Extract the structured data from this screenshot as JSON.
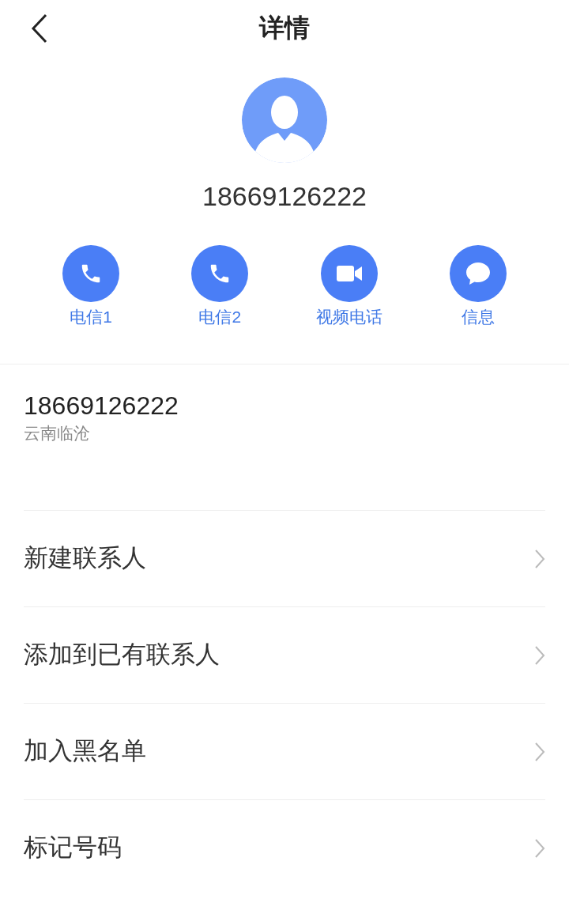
{
  "header": {
    "title": "详情"
  },
  "contact": {
    "number": "18669126222"
  },
  "actions": [
    {
      "label": "电信1",
      "kind": "phone"
    },
    {
      "label": "电信2",
      "kind": "phone"
    },
    {
      "label": "视频电话",
      "kind": "video"
    },
    {
      "label": "信息",
      "kind": "message"
    }
  ],
  "detail": {
    "number": "18669126222",
    "location": "云南临沧"
  },
  "menu": [
    {
      "label": "新建联系人"
    },
    {
      "label": "添加到已有联系人"
    },
    {
      "label": "加入黑名单"
    },
    {
      "label": "标记号码"
    }
  ]
}
